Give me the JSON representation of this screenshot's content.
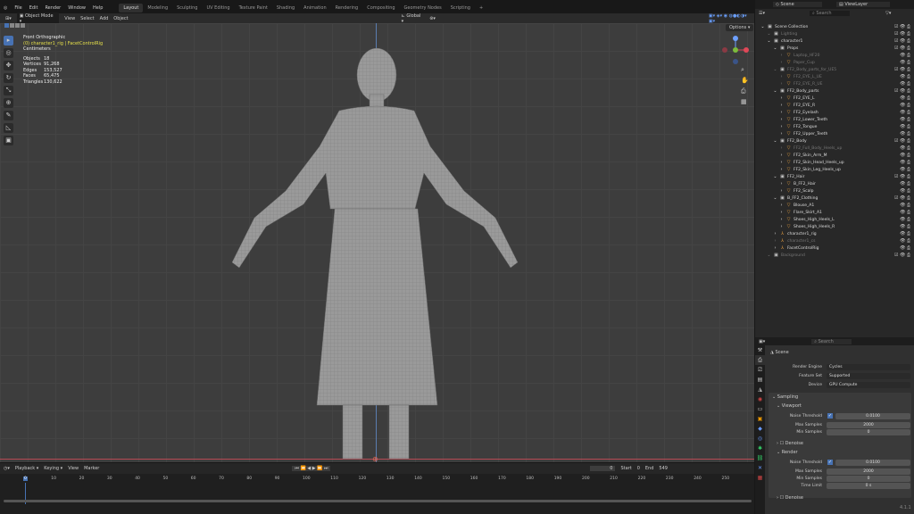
{
  "menus": [
    "File",
    "Edit",
    "Render",
    "Window",
    "Help"
  ],
  "workspaces": [
    "Layout",
    "Modeling",
    "Sculpting",
    "UV Editing",
    "Texture Paint",
    "Shading",
    "Animation",
    "Rendering",
    "Compositing",
    "Geometry Nodes",
    "Scripting",
    "+"
  ],
  "viewport_header": {
    "mode": "Object Mode",
    "menus": [
      "View",
      "Select",
      "Add",
      "Object"
    ],
    "orientation": "Global",
    "options": "Options"
  },
  "overlay": {
    "view": "Front Orthographic",
    "collection": "(0) character1_rig | FacetControlRig",
    "units": "Centimeters",
    "stats": [
      {
        "label": "Objects",
        "value": "18"
      },
      {
        "label": "Vertices",
        "value": "91,268"
      },
      {
        "label": "Edges",
        "value": "153,527"
      },
      {
        "label": "Faces",
        "value": "65,475"
      },
      {
        "label": "Triangles",
        "value": "130,622"
      }
    ]
  },
  "scene": {
    "label": "Scene",
    "viewlayer": "ViewLayer",
    "search": "Search"
  },
  "outliner": [
    {
      "d": 0,
      "name": "Scene Collection",
      "t": "col"
    },
    {
      "d": 1,
      "name": "Lighting",
      "t": "col",
      "dim": true
    },
    {
      "d": 1,
      "name": "character1",
      "t": "col"
    },
    {
      "d": 2,
      "name": "Props",
      "t": "col"
    },
    {
      "d": 3,
      "name": "Laptop_HF20",
      "t": "obj",
      "dim": true
    },
    {
      "d": 3,
      "name": "Paper_Cup",
      "t": "obj",
      "dim": true
    },
    {
      "d": 2,
      "name": "FF2_Body_parts_for_UE5",
      "t": "col",
      "dim": true
    },
    {
      "d": 3,
      "name": "FF2_EYE_L_UE",
      "t": "obj",
      "dim": true
    },
    {
      "d": 3,
      "name": "FF2_EYE_R_UE",
      "t": "obj",
      "dim": true
    },
    {
      "d": 2,
      "name": "FF2_Body_parts",
      "t": "col"
    },
    {
      "d": 3,
      "name": "FF2_EYE_L",
      "t": "obj"
    },
    {
      "d": 3,
      "name": "FF2_EYE_R",
      "t": "obj"
    },
    {
      "d": 3,
      "name": "FF2_Eyelash",
      "t": "obj"
    },
    {
      "d": 3,
      "name": "FF2_Lower_Teeth",
      "t": "obj"
    },
    {
      "d": 3,
      "name": "FF2_Tongue",
      "t": "obj"
    },
    {
      "d": 3,
      "name": "FF2_Upper_Teeth",
      "t": "obj"
    },
    {
      "d": 2,
      "name": "FF2_Body",
      "t": "col"
    },
    {
      "d": 3,
      "name": "FF2_Full_Body_Heels_up",
      "t": "obj",
      "dim": true
    },
    {
      "d": 3,
      "name": "FF2_Skin_Arm_M",
      "t": "obj"
    },
    {
      "d": 3,
      "name": "FF2_Skin_Head_Heels_up",
      "t": "obj"
    },
    {
      "d": 3,
      "name": "FF2_Skin_Leg_Heels_up",
      "t": "obj"
    },
    {
      "d": 2,
      "name": "FF2_Hair",
      "t": "col"
    },
    {
      "d": 3,
      "name": "B_FF2_Hair",
      "t": "obj"
    },
    {
      "d": 3,
      "name": "FF2_Scalp",
      "t": "obj"
    },
    {
      "d": 2,
      "name": "B_FF2_Clothing",
      "t": "col"
    },
    {
      "d": 3,
      "name": "Blouse_A1",
      "t": "obj"
    },
    {
      "d": 3,
      "name": "Flare_Skirt_A1",
      "t": "obj"
    },
    {
      "d": 3,
      "name": "Shoes_High_Heels_L",
      "t": "obj"
    },
    {
      "d": 3,
      "name": "Shoes_High_Heels_R",
      "t": "obj"
    },
    {
      "d": 2,
      "name": "character1_rig",
      "t": "rig"
    },
    {
      "d": 2,
      "name": "character1_cs",
      "t": "rig",
      "dim": true
    },
    {
      "d": 2,
      "name": "FacetControlRig",
      "t": "rig"
    },
    {
      "d": 1,
      "name": "Background",
      "t": "col",
      "dim": true
    }
  ],
  "properties": {
    "search": "Search",
    "scene": "Scene",
    "render_engine": {
      "label": "Render Engine",
      "value": "Cycles"
    },
    "feature_set": {
      "label": "Feature Set",
      "value": "Supported"
    },
    "device": {
      "label": "Device",
      "value": "GPU Compute"
    },
    "sampling": "Sampling",
    "viewport": "Viewport",
    "render": "Render",
    "denoise": "Denoise",
    "v_noise": {
      "label": "Noise Threshold",
      "value": "0.0100"
    },
    "v_max": {
      "label": "Max Samples",
      "value": "2000"
    },
    "v_min": {
      "label": "Min Samples",
      "value": "0"
    },
    "r_noise": {
      "label": "Noise Threshold",
      "value": "0.0100"
    },
    "r_max": {
      "label": "Max Samples",
      "value": "2000"
    },
    "r_min": {
      "label": "Min Samples",
      "value": "0"
    },
    "r_time": {
      "label": "Time Limit",
      "value": "0 s"
    }
  },
  "timeline": {
    "menus": [
      "Playback",
      "Keying",
      "View",
      "Marker"
    ],
    "current": "0",
    "start_label": "Start",
    "start": "0",
    "end_label": "End",
    "end": "549",
    "ticks": [
      "0",
      "10",
      "20",
      "30",
      "40",
      "50",
      "60",
      "70",
      "80",
      "90",
      "100",
      "110",
      "120",
      "130",
      "140",
      "150",
      "160",
      "170",
      "180",
      "190",
      "200",
      "210",
      "220",
      "230",
      "240",
      "250"
    ]
  },
  "version": "4.1.1"
}
